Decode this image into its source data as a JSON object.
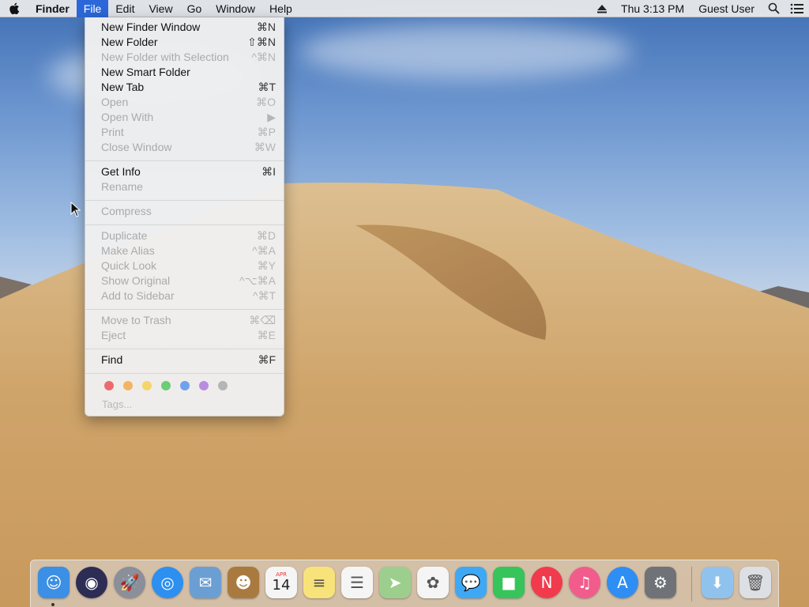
{
  "menubar": {
    "apple_icon": "apple-logo",
    "app_name": "Finder",
    "menus": [
      "File",
      "Edit",
      "View",
      "Go",
      "Window",
      "Help"
    ],
    "active_menu": "File",
    "clock": "Thu 3:13 PM",
    "user": "Guest User"
  },
  "file_menu": {
    "items": [
      {
        "label": "New Finder Window",
        "shortcut": "⌘N",
        "enabled": true
      },
      {
        "label": "New Folder",
        "shortcut": "⇧⌘N",
        "enabled": true
      },
      {
        "label": "New Folder with Selection",
        "shortcut": "^⌘N",
        "enabled": false
      },
      {
        "label": "New Smart Folder",
        "shortcut": "",
        "enabled": true
      },
      {
        "label": "New Tab",
        "shortcut": "⌘T",
        "enabled": true
      },
      {
        "label": "Open",
        "shortcut": "⌘O",
        "enabled": false
      },
      {
        "label": "Open With",
        "shortcut": "▶",
        "enabled": false
      },
      {
        "label": "Print",
        "shortcut": "⌘P",
        "enabled": false
      },
      {
        "label": "Close Window",
        "shortcut": "⌘W",
        "enabled": false
      },
      {
        "label": "Get Info",
        "shortcut": "⌘I",
        "enabled": true
      },
      {
        "label": "Rename",
        "shortcut": "",
        "enabled": false
      },
      {
        "label": "Compress",
        "shortcut": "",
        "enabled": false
      },
      {
        "label": "Duplicate",
        "shortcut": "⌘D",
        "enabled": false
      },
      {
        "label": "Make Alias",
        "shortcut": "^⌘A",
        "enabled": false
      },
      {
        "label": "Quick Look",
        "shortcut": "⌘Y",
        "enabled": false
      },
      {
        "label": "Show Original",
        "shortcut": "^⌥⌘A",
        "enabled": false
      },
      {
        "label": "Add to Sidebar",
        "shortcut": "^⌘T",
        "enabled": false
      },
      {
        "label": "Move to Trash",
        "shortcut": "⌘⌫",
        "enabled": false
      },
      {
        "label": "Eject",
        "shortcut": "⌘E",
        "enabled": false
      },
      {
        "label": "Find",
        "shortcut": "⌘F",
        "enabled": true
      }
    ],
    "tag_colors": [
      "#ec6a6f",
      "#f2b462",
      "#f4d56c",
      "#6ccd77",
      "#6fa2ec",
      "#b98ce0",
      "#b5b5b8"
    ],
    "tags_label": "Tags..."
  },
  "dock": {
    "apps": [
      {
        "name": "finder-icon",
        "color": "#3b8fe5",
        "glyph": "☺"
      },
      {
        "name": "siri-icon",
        "color": "#2c2c54",
        "glyph": "◉"
      },
      {
        "name": "launchpad-icon",
        "color": "#8a8f99",
        "glyph": "🚀"
      },
      {
        "name": "safari-icon",
        "color": "#2d8ff0",
        "glyph": "◎"
      },
      {
        "name": "mail-icon",
        "color": "#6b9fd4",
        "glyph": "✉"
      },
      {
        "name": "contacts-icon",
        "color": "#a97a3f",
        "glyph": "☻"
      },
      {
        "name": "calendar-icon",
        "color": "#f5f5f5",
        "glyph": "14",
        "month": "APR"
      },
      {
        "name": "notes-icon",
        "color": "#f7e37a",
        "glyph": "≡"
      },
      {
        "name": "reminders-icon",
        "color": "#f5f5f5",
        "glyph": "☰"
      },
      {
        "name": "maps-icon",
        "color": "#9ccf8d",
        "glyph": "➤"
      },
      {
        "name": "photos-icon",
        "color": "#f5f5f5",
        "glyph": "✿"
      },
      {
        "name": "messages-icon",
        "color": "#3ea8f5",
        "glyph": "💬"
      },
      {
        "name": "facetime-icon",
        "color": "#37c45b",
        "glyph": "■"
      },
      {
        "name": "news-icon",
        "color": "#f23a4d",
        "glyph": "N"
      },
      {
        "name": "itunes-icon",
        "color": "#f25c8c",
        "glyph": "♫"
      },
      {
        "name": "app-store-icon",
        "color": "#2e8ef3",
        "glyph": "A"
      },
      {
        "name": "system-preferences-icon",
        "color": "#6f7377",
        "glyph": "⚙"
      },
      {
        "name": "downloads-folder-icon",
        "color": "#8fc3ee",
        "glyph": "⬇"
      },
      {
        "name": "trash-icon",
        "color": "#dcdfe3",
        "glyph": "🗑"
      }
    ]
  }
}
